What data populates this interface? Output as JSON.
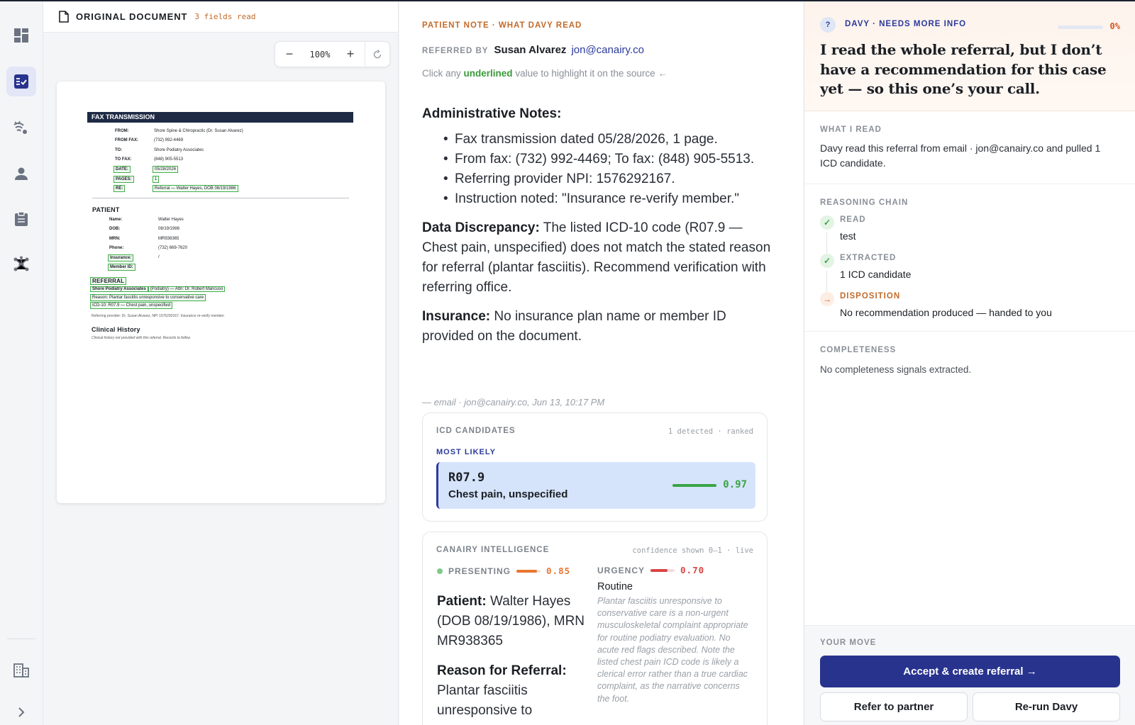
{
  "rail": {
    "items": [
      {
        "icon": "dashboard-icon"
      },
      {
        "icon": "referrals-icon",
        "active": true
      },
      {
        "icon": "signal-icon"
      },
      {
        "icon": "person-icon"
      },
      {
        "icon": "clipboard-icon"
      },
      {
        "icon": "network-icon"
      },
      {
        "icon": "building-icon"
      },
      {
        "icon": "chevron-right-icon"
      }
    ]
  },
  "doc": {
    "title": "ORIGINAL DOCUMENT",
    "fields_read": "3 fields read",
    "zoom": "100%",
    "fax_title": "FAX TRANSMISSION",
    "fax_fields": [
      {
        "k": "FROM:",
        "v": "Shore Spine & Chiropractic (Dr. Susan Alvarez)"
      },
      {
        "k": "FROM FAX:",
        "v": "(732) 992-4469"
      },
      {
        "k": "TO:",
        "v": "Shore Podiatry Associates"
      },
      {
        "k": "TO FAX:",
        "v": "(848) 905-5513"
      },
      {
        "k": "DATE:",
        "v": "05/28/2026"
      },
      {
        "k": "PAGES:",
        "v": "1"
      },
      {
        "k": "RE:",
        "v": "Referral — Walter Hayes, DOB 08/19/1986"
      }
    ],
    "patient_title": "PATIENT",
    "patient_fields": [
      {
        "k": "Name:",
        "v": "Walter Hayes"
      },
      {
        "k": "DOB:",
        "v": "08/19/1986"
      },
      {
        "k": "MRN:",
        "v": "MR938365"
      },
      {
        "k": "Phone:",
        "v": "(732) 669-7620"
      },
      {
        "k": "Insurance:",
        "v": "/"
      },
      {
        "k": "Member ID:",
        "v": ""
      }
    ],
    "referral_title": "REFERRAL",
    "referral_to_org": "Shore Podiatry Associates",
    "referral_to_rest": "(Podiatry) — Attn: Dr. Robert Mancuso",
    "referral_reason": "Reason: Plantar fasciitis unresponsive to conservative care",
    "referral_icd": "ICD-10: R07.9 — Chest pain, unspecified",
    "provider_note": "Referring provider: Dr. Susan Alvarez, NPI 1576292167. Insurance re-verify member.",
    "clinical_title": "Clinical History",
    "clinical_note": "Clinical history not provided with this referral. Records to follow."
  },
  "note": {
    "eyebrow": "PATIENT NOTE · WHAT DAVY READ",
    "referred_label": "REFERRED BY",
    "referrer_name": "Susan Alvarez",
    "referrer_email": "jon@canairy.co",
    "hint_pre": "Click any",
    "hint_u": "underlined",
    "hint_post": "value to highlight it on the source ←",
    "admin_title": "Administrative Notes:",
    "admin_items": [
      "Fax transmission dated 05/28/2026, 1 page.",
      "From fax: (732) 992-4469; To fax: (848) 905-5513.",
      "Referring provider NPI: 1576292167.",
      "Instruction noted: \"Insurance re-verify member.\""
    ],
    "disc_label": "Data Discrepancy:",
    "disc_text": "The listed ICD-10 code (R07.9 — Chest pain, unspecified) does not match the stated reason for referral (plantar fasciitis). Recommend verification with referring office.",
    "ins_label": "Insurance:",
    "ins_text": "No insurance plan name or member ID provided on the document.",
    "source": "— email · jon@canairy.co, Jun 13, 10:17 PM"
  },
  "icd": {
    "eyebrow": "ICD CANDIDATES",
    "meta": "1 detected · ranked",
    "most_likely": "MOST LIKELY",
    "code": "R07.9",
    "desc": "Chest pain, unspecified",
    "score": 0.97,
    "score_label": "0.97"
  },
  "ci": {
    "eyebrow": "CANAIRY INTELLIGENCE",
    "meta": "confidence shown 0–1 · live",
    "presenting_label": "PRESENTING",
    "presenting_score": 0.85,
    "presenting_score_label": "0.85",
    "urgency_label": "URGENCY",
    "urgency_score": 0.7,
    "urgency_score_label": "0.70",
    "urgency_value": "Routine",
    "urgency_text": "Plantar fasciitis unresponsive to conservative care is a non-urgent musculoskeletal complaint appropriate for routine podiatry evaluation. No acute red flags described. Note the listed chest pain ICD code is likely a clerical error rather than a true cardiac complaint, as the narrative concerns the foot.",
    "patient_label": "Patient:",
    "patient_text": "Walter Hayes (DOB 08/19/1986), MRN MR938365",
    "reason_label": "Reason for Referral:",
    "reason_text": "Plantar fasciitis unresponsive to"
  },
  "davy": {
    "badge": "?",
    "eyebrow": "DAVY · NEEDS MORE INFO",
    "progress": 0.0,
    "progress_label": "0%",
    "quote": "I read the whole referral, but I don’t have a recommendation for this case yet — so this one’s your call.",
    "what_read_label": "WHAT I READ",
    "what_read_text": "Davy read this referral from email · jon@canairy.co and pulled 1 ICD candidate.",
    "chain_label": "REASONING CHAIN",
    "chain": [
      {
        "label": "READ",
        "value": "test",
        "status": "done"
      },
      {
        "label": "EXTRACTED",
        "value": "1 ICD candidate",
        "status": "done"
      },
      {
        "label": "DISPOSITION",
        "value": "No recommendation produced — handed to you",
        "status": "handoff"
      }
    ],
    "completeness_label": "COMPLETENESS",
    "completeness_text": "No completeness signals extracted.",
    "move_label": "YOUR MOVE",
    "accept_label": "Accept & create referral →",
    "refer_label": "Refer to partner",
    "rerun_label": "Re-run Davy"
  },
  "colors": {
    "accent": "#28338e",
    "orange": "#c26b2a",
    "green": "#3aa446",
    "red": "#d9541e"
  }
}
